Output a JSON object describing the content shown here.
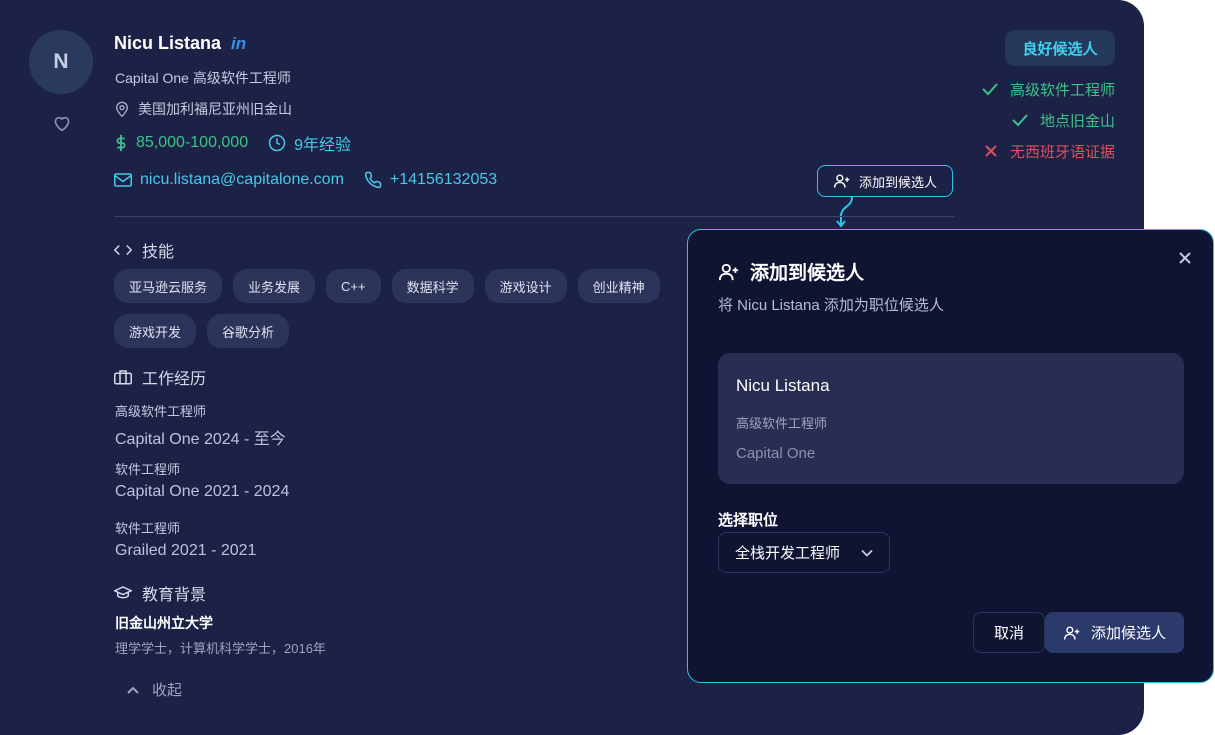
{
  "profile": {
    "avatar_initial": "N",
    "name": "Nicu Listana",
    "linkedin_label": "in",
    "title_line": "Capital One 高级软件工程师",
    "location": "美国加利福尼亚州旧金山",
    "salary": "85,000-100,000",
    "experience": "9年经验",
    "email": "nicu.listana@capitalone.com",
    "phone": "+14156132053",
    "add_candidate_label": "添加到候选人"
  },
  "match": {
    "badge": "良好候选人",
    "criteria": [
      {
        "label": "高级软件工程师",
        "status": "match"
      },
      {
        "label": "地点旧金山",
        "status": "match"
      },
      {
        "label": "无西班牙语证据",
        "status": "miss"
      }
    ],
    "colors": {
      "match": "#3cc38b",
      "miss": "#e04f5a",
      "accent": "#2ec4e6"
    }
  },
  "skills": {
    "heading": "技能",
    "items": [
      "亚马逊云服务",
      "业务发展",
      "C++",
      "数据科学",
      "游戏设计",
      "创业精神",
      "游戏开发",
      "谷歌分析"
    ]
  },
  "work": {
    "heading": "工作经历",
    "items": [
      {
        "title": "高级软件工程师",
        "company_period": "Capital One  2024 - 至今"
      },
      {
        "title": "软件工程师",
        "company_period": "Capital One  2021 - 2024"
      },
      {
        "title": "软件工程师",
        "company_period": "Grailed  2021 - 2021"
      }
    ]
  },
  "education": {
    "heading": "教育背景",
    "school": "旧金山州立大学",
    "degree": "理学学士，计算机科学学士，2016年"
  },
  "collapse_label": "收起",
  "modal": {
    "title": "添加到候选人",
    "subtitle": "将 Nicu Listana 添加为职位候选人",
    "candidate_name": "Nicu Listana",
    "candidate_title": "高级软件工程师",
    "candidate_company": "Capital One",
    "select_label": "选择职位",
    "select_value": "全栈开发工程师",
    "cancel_label": "取消",
    "confirm_label": "添加候选人"
  }
}
